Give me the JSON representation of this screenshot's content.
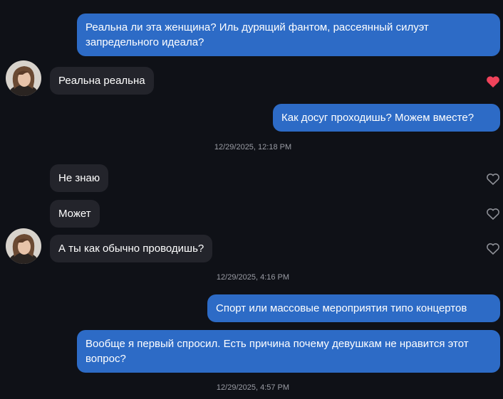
{
  "messages": [
    {
      "id": "m1",
      "dir": "out",
      "text": "Реальна ли эта женщина? Иль дурящий фантом, рассеянный силуэт запредельного идеала?"
    },
    {
      "id": "m2",
      "dir": "in",
      "text": "Реальна реальна",
      "liked": true
    },
    {
      "id": "m3",
      "dir": "out",
      "text": "Как досуг проходишь? Можем вместе?"
    },
    {
      "id": "m4",
      "dir": "in",
      "text": "Не знаю",
      "liked": false
    },
    {
      "id": "m5",
      "dir": "in",
      "text": "Может",
      "liked": false
    },
    {
      "id": "m6",
      "dir": "in",
      "text": "А ты как обычно проводишь?",
      "liked": false
    },
    {
      "id": "m7",
      "dir": "out",
      "text": "Спорт или массовые мероприятия типо концертов"
    },
    {
      "id": "m8",
      "dir": "out",
      "text": "Вообще я первый спросил. Есть причина почему девушкам не нравится этот вопрос?"
    }
  ],
  "timestamps": [
    "12/29/2025, 12:18 PM",
    "12/29/2025, 4:16 PM",
    "12/29/2025, 4:57 PM"
  ],
  "colors": {
    "background": "#0f1117",
    "outgoing_bubble": "#2d6bc6",
    "incoming_bubble": "#23242b",
    "liked_heart": "#f0435b",
    "unliked_heart": "#8e9097",
    "timestamp_text": "#9a9ca4"
  }
}
